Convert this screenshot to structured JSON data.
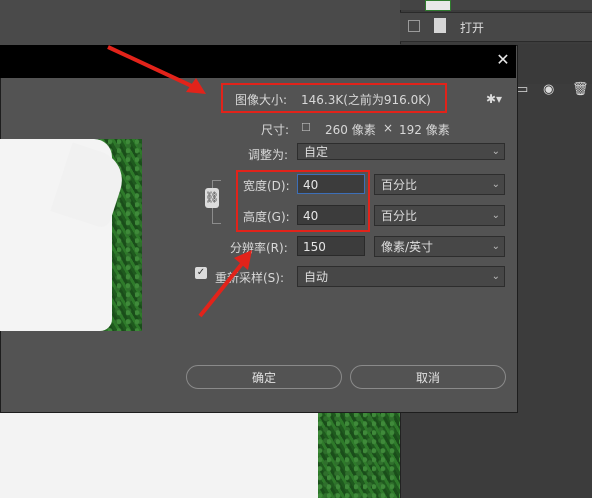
{
  "background": {
    "layers_panel": {
      "layer_label": "打开"
    }
  },
  "dialog": {
    "image_size_label": "图像大小:",
    "image_size_value": "146.3K(之前为916.0K)",
    "dimensions_label": "尺寸:",
    "dimensions_width": "260 像素",
    "dimensions_times": "×",
    "dimensions_height": "192 像素",
    "fit_to_label": "调整为:",
    "fit_to_value": "自定",
    "width_label": "宽度(D):",
    "width_value": "40",
    "width_unit": "百分比",
    "height_label": "高度(G):",
    "height_value": "40",
    "height_unit": "百分比",
    "resolution_label": "分辨率(R):",
    "resolution_value": "150",
    "resolution_unit": "像素/英寸",
    "resample_label": "重新采样(S):",
    "resample_value": "自动",
    "ok_label": "确定",
    "cancel_label": "取消"
  },
  "colors": {
    "annotation_red": "#e2231a",
    "dialog_bg": "#535353"
  },
  "icons": [
    "close-icon",
    "gear-icon",
    "chain-link-icon",
    "checkbox-checked-icon",
    "chevron-down-icon",
    "camera-icon",
    "trash-icon",
    "document-icon"
  ]
}
